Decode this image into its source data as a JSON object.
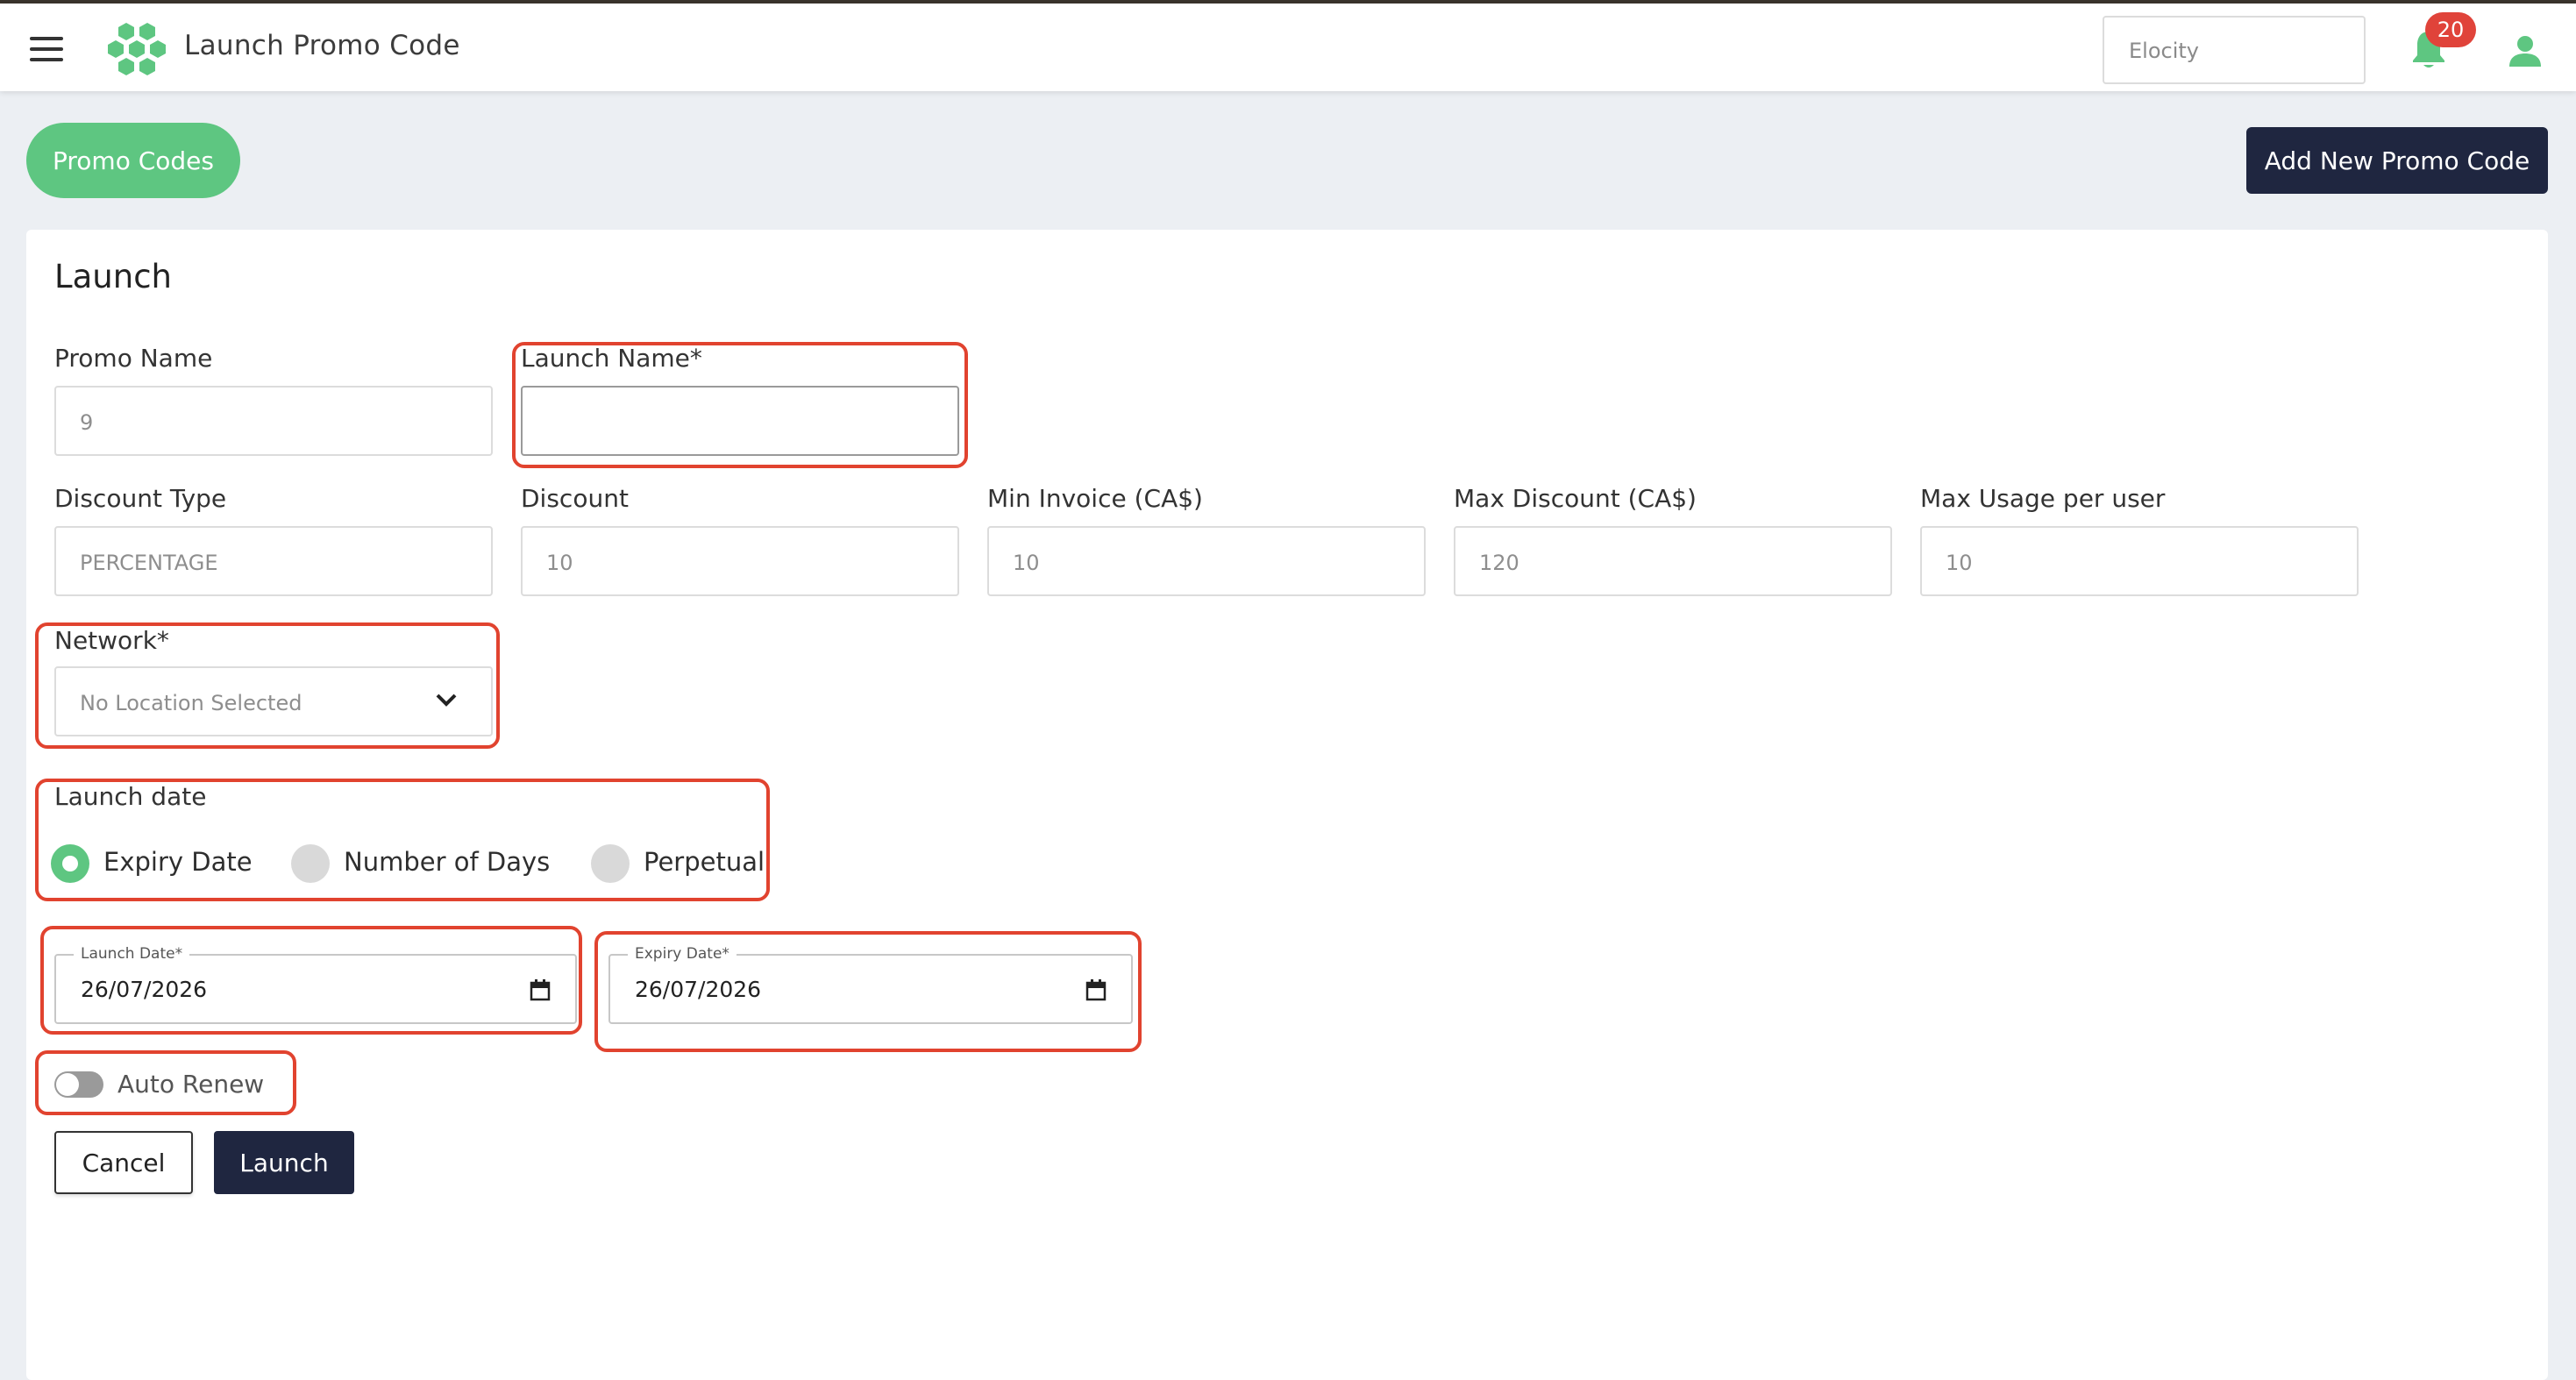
{
  "header": {
    "title": "Launch Promo Code",
    "company": "Elocity",
    "notification_count": "20"
  },
  "toolbar": {
    "promo_codes_label": "Promo Codes",
    "add_new_label": "Add New Promo Code"
  },
  "form": {
    "title": "Launch",
    "promo_name": {
      "label": "Promo Name",
      "value": "9"
    },
    "launch_name": {
      "label": "Launch Name*",
      "value": ""
    },
    "discount_type": {
      "label": "Discount Type",
      "value": "PERCENTAGE"
    },
    "discount": {
      "label": "Discount",
      "value": "10"
    },
    "min_invoice": {
      "label": "Min Invoice (CA$)",
      "value": "10"
    },
    "max_discount": {
      "label": "Max Discount (CA$)",
      "value": "120"
    },
    "max_usage": {
      "label": "Max Usage per user",
      "value": "10"
    },
    "network": {
      "label": "Network*",
      "value": "No Location Selected"
    },
    "launch_date_group": {
      "label": "Launch date",
      "options": [
        {
          "label": "Expiry Date",
          "selected": true
        },
        {
          "label": "Number of Days",
          "selected": false
        },
        {
          "label": "Perpetual",
          "selected": false
        }
      ]
    },
    "launch_date": {
      "label": "Launch Date*",
      "value": "26/07/2026"
    },
    "expiry_date": {
      "label": "Expiry Date*",
      "value": "26/07/2026"
    },
    "auto_renew": {
      "label": "Auto Renew",
      "enabled": false
    },
    "cancel_label": "Cancel",
    "launch_label": "Launch"
  },
  "colors": {
    "accent_green": "#5ec681",
    "primary_dark": "#1f2640",
    "highlight_red": "#e1432f",
    "badge_red": "#e0433a"
  }
}
